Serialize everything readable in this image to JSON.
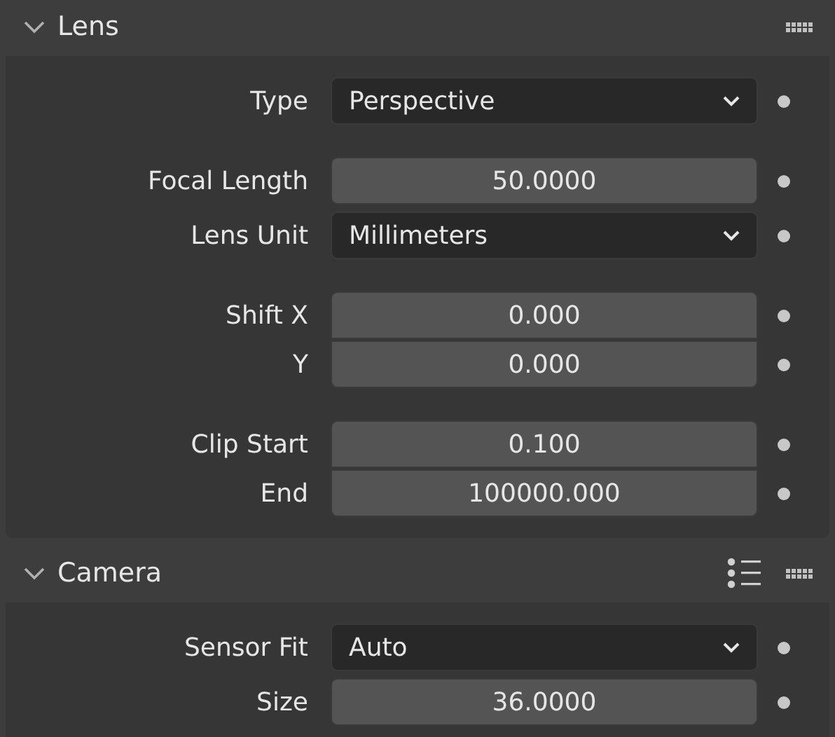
{
  "panels": [
    {
      "title": "Lens",
      "expanded": true,
      "presets_button": false,
      "groups": [
        {
          "joined": false,
          "rows": [
            {
              "label": "Type",
              "kind": "dropdown",
              "value": "Perspective"
            }
          ]
        },
        {
          "joined": false,
          "rows": [
            {
              "label": "Focal Length",
              "kind": "number",
              "value": "50.0000"
            },
            {
              "label": "Lens Unit",
              "kind": "dropdown",
              "value": "Millimeters"
            }
          ]
        },
        {
          "joined": true,
          "rows": [
            {
              "label": "Shift X",
              "kind": "number",
              "value": "0.000"
            },
            {
              "label": "Y",
              "kind": "number",
              "value": "0.000"
            }
          ]
        },
        {
          "joined": true,
          "rows": [
            {
              "label": "Clip Start",
              "kind": "number",
              "value": "0.100"
            },
            {
              "label": "End",
              "kind": "number",
              "value": "100000.000"
            }
          ]
        }
      ]
    },
    {
      "title": "Camera",
      "expanded": true,
      "presets_button": true,
      "groups": [
        {
          "joined": false,
          "rows": [
            {
              "label": "Sensor Fit",
              "kind": "dropdown",
              "value": "Auto"
            },
            {
              "label": "Size",
              "kind": "number",
              "value": "36.0000"
            }
          ]
        }
      ]
    }
  ]
}
